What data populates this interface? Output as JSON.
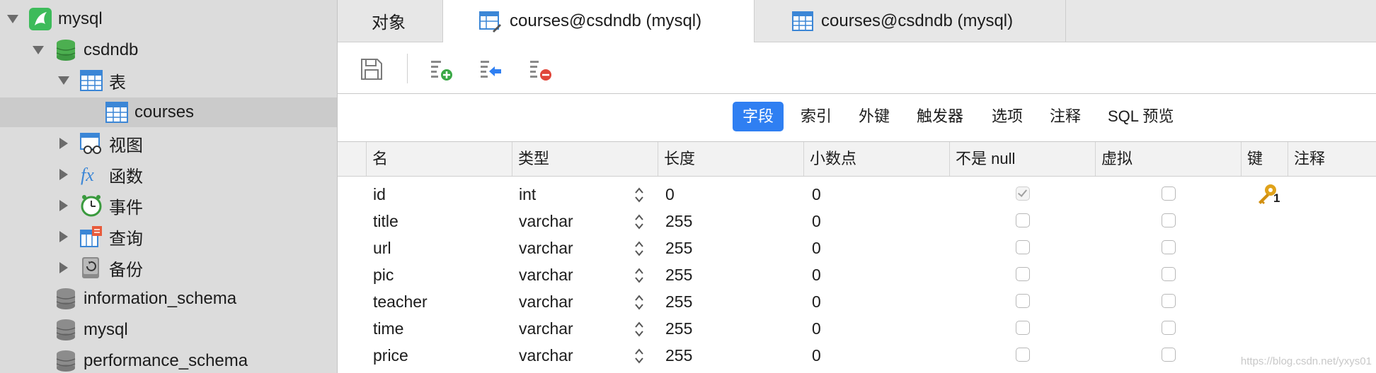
{
  "sidebar": {
    "items": [
      {
        "label": "mysql",
        "icon": "connection-icon"
      },
      {
        "label": "csdndb",
        "icon": "database-icon"
      },
      {
        "label": "表",
        "icon": "table-group-icon"
      },
      {
        "label": "courses",
        "icon": "table-icon"
      },
      {
        "label": "视图",
        "icon": "view-icon"
      },
      {
        "label": "函数",
        "icon": "function-icon"
      },
      {
        "label": "事件",
        "icon": "event-clock-icon"
      },
      {
        "label": "查询",
        "icon": "query-icon"
      },
      {
        "label": "备份",
        "icon": "backup-icon"
      },
      {
        "label": "information_schema",
        "icon": "database-icon"
      },
      {
        "label": "mysql",
        "icon": "database-icon"
      },
      {
        "label": "performance_schema",
        "icon": "database-icon"
      }
    ]
  },
  "tabs": [
    {
      "label": "对象"
    },
    {
      "label": "courses@csdndb (mysql)"
    },
    {
      "label": "courses@csdndb (mysql)"
    }
  ],
  "toolbar": {
    "buttons": [
      "save-icon",
      "add-field-icon",
      "insert-field-icon",
      "delete-field-icon"
    ]
  },
  "subtabs": [
    "字段",
    "索引",
    "外键",
    "触发器",
    "选项",
    "注释",
    "SQL 预览"
  ],
  "grid": {
    "columns": [
      "名",
      "类型",
      "长度",
      "小数点",
      "不是 null",
      "虚拟",
      "键",
      "注释"
    ],
    "rows": [
      {
        "name": "id",
        "type": "int",
        "length": "0",
        "decimals": "0",
        "not_null": true,
        "virtual": false,
        "key": "1"
      },
      {
        "name": "title",
        "type": "varchar",
        "length": "255",
        "decimals": "0",
        "not_null": false,
        "virtual": false,
        "key": ""
      },
      {
        "name": "url",
        "type": "varchar",
        "length": "255",
        "decimals": "0",
        "not_null": false,
        "virtual": false,
        "key": ""
      },
      {
        "name": "pic",
        "type": "varchar",
        "length": "255",
        "decimals": "0",
        "not_null": false,
        "virtual": false,
        "key": ""
      },
      {
        "name": "teacher",
        "type": "varchar",
        "length": "255",
        "decimals": "0",
        "not_null": false,
        "virtual": false,
        "key": ""
      },
      {
        "name": "time",
        "type": "varchar",
        "length": "255",
        "decimals": "0",
        "not_null": false,
        "virtual": false,
        "key": ""
      },
      {
        "name": "price",
        "type": "varchar",
        "length": "255",
        "decimals": "0",
        "not_null": false,
        "virtual": false,
        "key": ""
      }
    ]
  },
  "watermark": "https://blog.csdn.net/yxys01",
  "colors": {
    "accent": "#2f7ff2",
    "sidebar": "#dcdcdc",
    "key": "#e0a21a",
    "database": "#4caf50"
  }
}
